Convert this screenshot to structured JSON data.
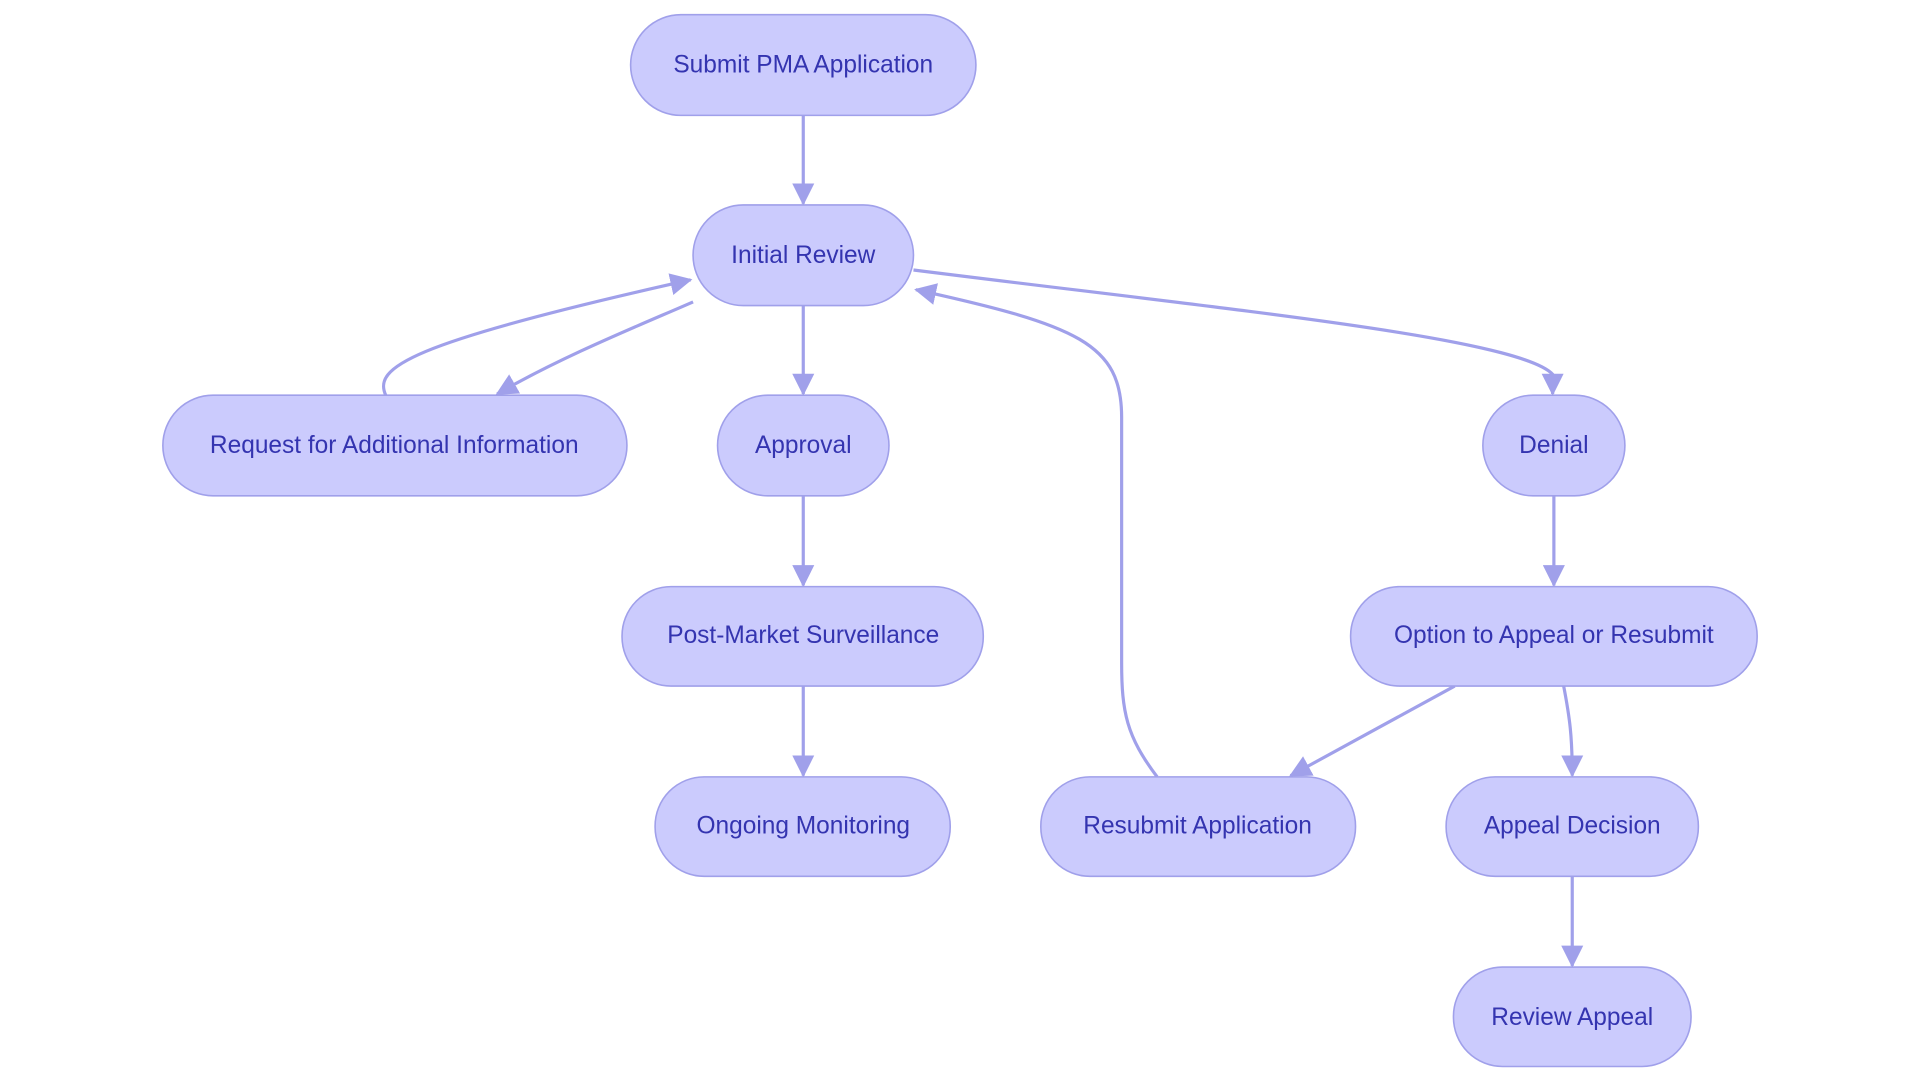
{
  "colors": {
    "node_fill": "#cbcbfd",
    "node_stroke": "#a0a0ea",
    "text": "#3434b0",
    "edge": "#a0a0ea"
  },
  "nodes": {
    "submit": "Submit PMA Application",
    "initial_review": "Initial Review",
    "request_info": "Request for Additional Information",
    "approval": "Approval",
    "denial": "Denial",
    "post_market": "Post-Market Surveillance",
    "option": "Option to Appeal or Resubmit",
    "ongoing": "Ongoing Monitoring",
    "resubmit": "Resubmit Application",
    "appeal_decision": "Appeal Decision",
    "review_appeal": "Review Appeal"
  },
  "edges": [
    [
      "Submit PMA Application",
      "Initial Review"
    ],
    [
      "Initial Review",
      "Request for Additional Information"
    ],
    [
      "Request for Additional Information",
      "Initial Review"
    ],
    [
      "Initial Review",
      "Approval"
    ],
    [
      "Initial Review",
      "Denial"
    ],
    [
      "Approval",
      "Post-Market Surveillance"
    ],
    [
      "Post-Market Surveillance",
      "Ongoing Monitoring"
    ],
    [
      "Denial",
      "Option to Appeal or Resubmit"
    ],
    [
      "Option to Appeal or Resubmit",
      "Resubmit Application"
    ],
    [
      "Option to Appeal or Resubmit",
      "Appeal Decision"
    ],
    [
      "Resubmit Application",
      "Initial Review"
    ],
    [
      "Appeal Decision",
      "Review Appeal"
    ]
  ]
}
